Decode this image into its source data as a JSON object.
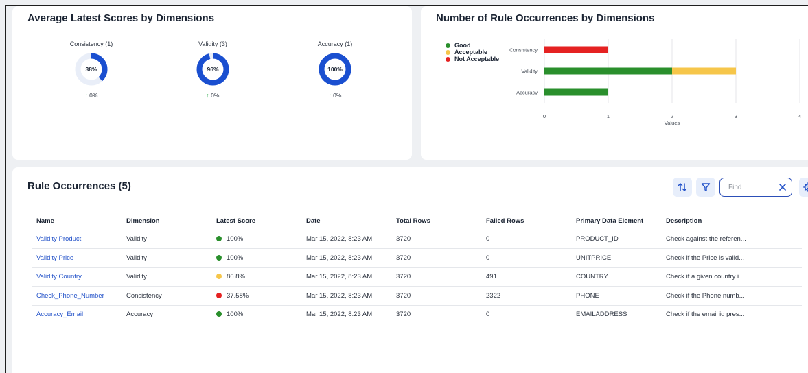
{
  "scores_card": {
    "title": "Average Latest Scores by Dimensions",
    "donuts": [
      {
        "label": "Consistency (1)",
        "value": "38%",
        "change": "0%",
        "change_arrow": "↑",
        "fraction": 0.38,
        "color": "#1a4fd0"
      },
      {
        "label": "Validity (3)",
        "value": "96%",
        "change": "0%",
        "change_arrow": "↑",
        "fraction": 0.96,
        "color": "#1a4fd0"
      },
      {
        "label": "Accuracy (1)",
        "value": "100%",
        "change": "0%",
        "change_arrow": "↑",
        "fraction": 1.0,
        "color": "#1a4fd0"
      }
    ]
  },
  "occurrences_card": {
    "title": "Number of Rule Occurrences by Dimensions",
    "legend": [
      {
        "label": "Good",
        "color": "#2a8f2c"
      },
      {
        "label": "Acceptable",
        "color": "#f6c64a"
      },
      {
        "label": "Not Acceptable",
        "color": "#e52222"
      }
    ]
  },
  "chart_data": {
    "type": "bar",
    "orientation": "horizontal",
    "stacked": true,
    "categories": [
      "Consistency",
      "Validity",
      "Accuracy"
    ],
    "series": [
      {
        "name": "Good",
        "color": "#2a8f2c",
        "values": [
          0,
          2,
          1
        ]
      },
      {
        "name": "Acceptable",
        "color": "#f6c64a",
        "values": [
          0,
          1,
          0
        ]
      },
      {
        "name": "Not Acceptable",
        "color": "#e52222",
        "values": [
          1,
          0,
          0
        ]
      }
    ],
    "xlabel": "Values",
    "xlim": [
      0,
      4
    ],
    "xticks": [
      "0",
      "1",
      "2",
      "3",
      "4"
    ],
    "grid": true
  },
  "rules_card": {
    "title": "Rule Occurrences (5)",
    "find_placeholder": "Find",
    "columns": [
      "Name",
      "Dimension",
      "Latest Score",
      "Date",
      "Total Rows",
      "Failed Rows",
      "Primary Data Element",
      "Description"
    ],
    "rows": [
      {
        "name": "Validity Product",
        "dimension": "Validity",
        "score": "100%",
        "score_color": "#2a8f2c",
        "date": "Mar 15, 2022, 8:23 AM",
        "total": "3720",
        "failed": "0",
        "element": "PRODUCT_ID",
        "description": "Check against the referen..."
      },
      {
        "name": "Validity Price",
        "dimension": "Validity",
        "score": "100%",
        "score_color": "#2a8f2c",
        "date": "Mar 15, 2022, 8:23 AM",
        "total": "3720",
        "failed": "0",
        "element": "UNITPRICE",
        "description": "Check if the Price is valid..."
      },
      {
        "name": "Validity Country",
        "dimension": "Validity",
        "score": "86.8%",
        "score_color": "#f6c64a",
        "date": "Mar 15, 2022, 8:23 AM",
        "total": "3720",
        "failed": "491",
        "element": "COUNTRY",
        "description": "Check if a given country i..."
      },
      {
        "name": "Check_Phone_Number",
        "dimension": "Consistency",
        "score": "37.58%",
        "score_color": "#e52222",
        "date": "Mar 15, 2022, 8:23 AM",
        "total": "3720",
        "failed": "2322",
        "element": "PHONE",
        "description": "Check if the Phone numb..."
      },
      {
        "name": "Accuracy_Email",
        "dimension": "Accuracy",
        "score": "100%",
        "score_color": "#2a8f2c",
        "date": "Mar 15, 2022, 8:23 AM",
        "total": "3720",
        "failed": "0",
        "element": "EMAILADDRESS",
        "description": "Check if the email id pres..."
      }
    ],
    "icons": {
      "sort": "sort-icon",
      "filter": "filter-icon",
      "clear": "close-icon",
      "settings": "gear-icon"
    }
  }
}
